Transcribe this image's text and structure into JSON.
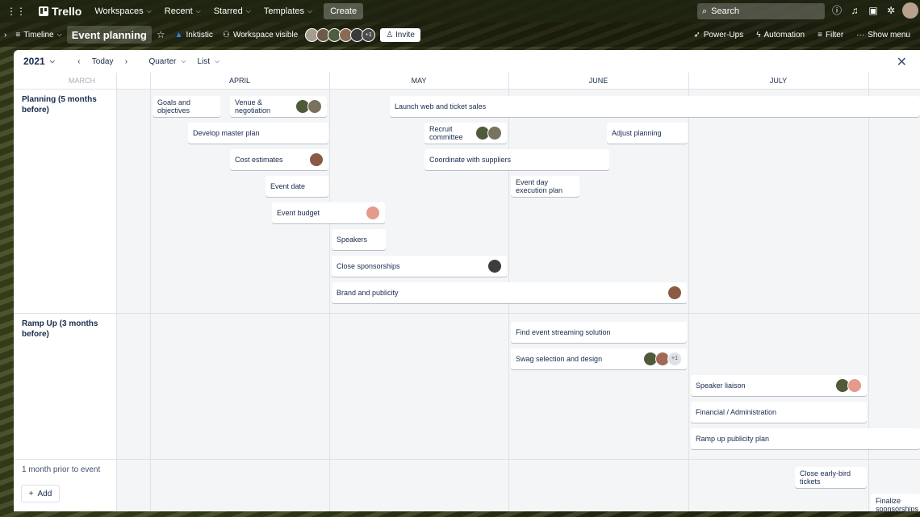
{
  "topnav": {
    "brand": "Trello",
    "menus": [
      "Workspaces",
      "Recent",
      "Starred",
      "Templates"
    ],
    "create": "Create",
    "search_placeholder": "Search"
  },
  "board": {
    "view": "Timeline",
    "name": "Event planning",
    "workspace": "Inktistic",
    "visibility": "Workspace visible",
    "member_extra": "+1",
    "invite": "Invite",
    "powerups": "Power-Ups",
    "automation": "Automation",
    "filter": "Filter",
    "show_menu": "Show menu"
  },
  "toolbar": {
    "year": "2021",
    "today": "Today",
    "range": "Quarter",
    "group": "List"
  },
  "months": [
    "MARCH",
    "APRIL",
    "MAY",
    "JUNE",
    "JULY"
  ],
  "lanes": [
    "Planning (5 months before)",
    "Ramp Up (3 months before)",
    "1 month prior to event"
  ],
  "cards": [
    {
      "title": "Goals and objectives"
    },
    {
      "title": "Venue & negotiation"
    },
    {
      "title": "Launch web and ticket sales"
    },
    {
      "title": "Develop master plan"
    },
    {
      "title": "Recruit committee"
    },
    {
      "title": "Adjust planning"
    },
    {
      "title": "Cost estimates"
    },
    {
      "title": "Coordinate with suppliers"
    },
    {
      "title": "Event date"
    },
    {
      "title": "Event day execution plan"
    },
    {
      "title": "Event budget"
    },
    {
      "title": "Speakers"
    },
    {
      "title": "Close sponsorships"
    },
    {
      "title": "Brand and publicity"
    },
    {
      "title": "Find event streaming solution"
    },
    {
      "title": "Swag selection and design",
      "more": "+1"
    },
    {
      "title": "Speaker liaison"
    },
    {
      "title": "Financial / Administration"
    },
    {
      "title": "Ramp up publicity plan"
    },
    {
      "title": "Close early-bird tickets"
    },
    {
      "title": "Finalize sponsorships"
    }
  ],
  "add_label": "Add",
  "colors": {
    "topbar": "#1e2210",
    "panel": "#f4f5f7",
    "card": "#ffffff"
  }
}
